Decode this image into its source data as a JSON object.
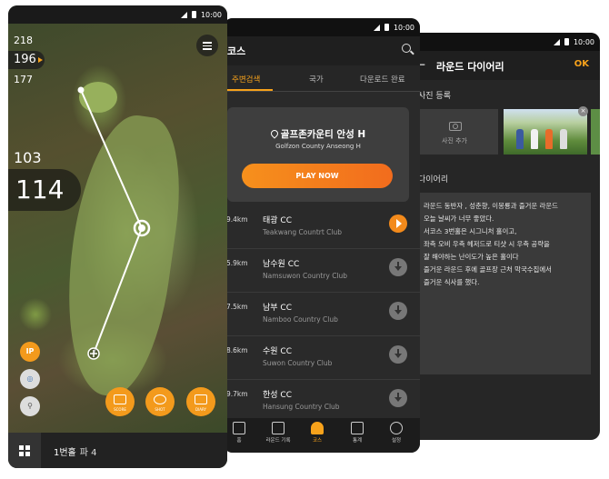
{
  "status": {
    "time": "10:00"
  },
  "map_screen": {
    "yardages": [
      "218",
      "196",
      "177"
    ],
    "distance_small": "103",
    "distance_large": "114",
    "ip_label": "IP",
    "score_label": "SCORE",
    "shot_label": "SHOT",
    "diary_label": "DIARY",
    "hole_label": "1번홀",
    "par_label": "파 4"
  },
  "course_screen": {
    "title": "코스",
    "tabs": [
      "주변검색",
      "국가",
      "다운로드 완료"
    ],
    "featured": {
      "name_kr": "골프존카운티 안성 H",
      "name_en": "Golfzon County Anseong H",
      "play_label": "PLAY NOW"
    },
    "courses": [
      {
        "distance": "9.4km",
        "name_kr": "태광 CC",
        "name_en": "Teakwang Countrt Club",
        "action": "play"
      },
      {
        "distance": "5.9km",
        "name_kr": "남수원 CC",
        "name_en": "Namsuwon Country Club",
        "action": "download"
      },
      {
        "distance": "7.5km",
        "name_kr": "남부 CC",
        "name_en": "Namboo Country Club",
        "action": "download"
      },
      {
        "distance": "8.6km",
        "name_kr": "수원 CC",
        "name_en": "Suwon Country Club",
        "action": "download"
      },
      {
        "distance": "9.7km",
        "name_kr": "한성 CC",
        "name_en": "Hansung Country Club",
        "action": "download"
      }
    ],
    "nav": [
      "홈",
      "라운드 기록",
      "코스",
      "통계",
      "설정"
    ]
  },
  "diary_screen": {
    "title": "라운드 다이어리",
    "ok_label": "OK",
    "photo_section": "사진 등록",
    "add_photo_label": "사진 추가",
    "diary_section": "다이어리",
    "diary_text": "라운드 동반자 , 성춘향, 이몽룡과 즐거운 라운드\n오늘 날씨가 너무 좋았다.\n서코스 3번홀은 시그니처 홀이고,\n좌측 오비 우측 헤저드로 티샷 시 우측 공략을\n잘 해야하는 난이도가 높은 홀이다\n즐거운 라운드 후에 골프장 근처 막국수집에서\n즐거운 식사를 했다."
  },
  "colors": {
    "accent": "#f7a21b"
  }
}
